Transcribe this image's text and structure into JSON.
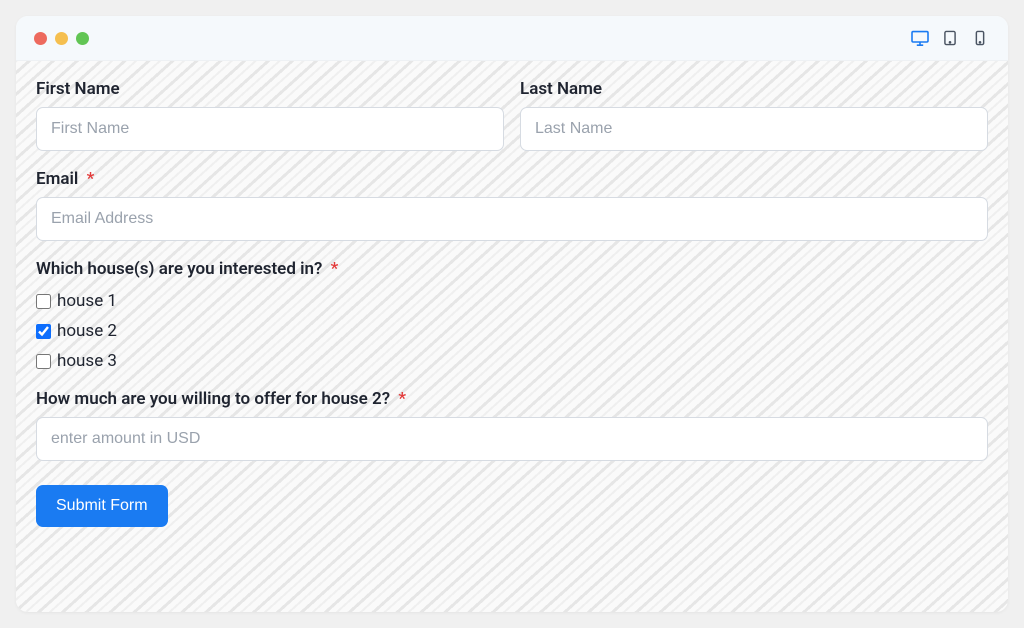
{
  "form": {
    "first_name": {
      "label": "First Name",
      "placeholder": "First Name"
    },
    "last_name": {
      "label": "Last Name",
      "placeholder": "Last Name"
    },
    "email": {
      "label": "Email",
      "placeholder": "Email Address",
      "required_marker": "*"
    },
    "houses": {
      "label": "Which house(s) are you interested in?",
      "required_marker": "*",
      "options": [
        {
          "label": "house 1",
          "checked": false
        },
        {
          "label": "house 2",
          "checked": true
        },
        {
          "label": "house 3",
          "checked": false
        }
      ]
    },
    "offer": {
      "label": "How much are you willing to offer for house 2?",
      "required_marker": "*",
      "placeholder": "enter amount in USD"
    },
    "submit_label": "Submit Form"
  }
}
